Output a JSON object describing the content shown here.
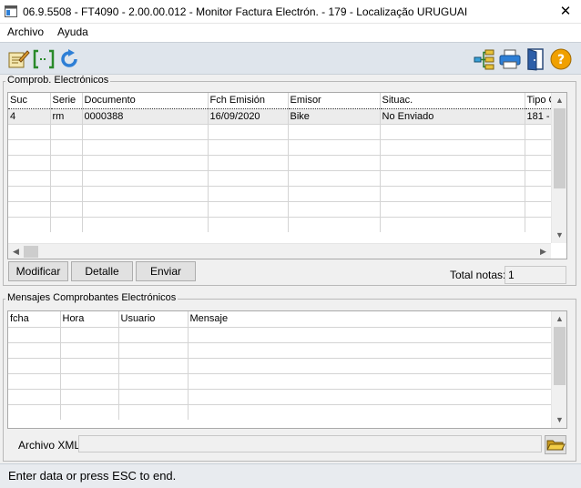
{
  "window": {
    "title": "06.9.5508 - FT4090 - 2.00.00.012 - Monitor Factura Electrón. - 179 - Localização URUGUAI",
    "close_glyph": "✕"
  },
  "menu": {
    "archivo": "Archivo",
    "ayuda": "Ayuda"
  },
  "toolbar": {
    "left_icons": [
      "document-edit-icon",
      "bracket-select-icon",
      "refresh-icon"
    ],
    "right_icons": [
      "tree-icon",
      "printer-icon",
      "exit-door-icon",
      "help-icon"
    ]
  },
  "comprobantes": {
    "group_label": "Comprob. Electrónicos",
    "columns": [
      "Suc",
      "Serie",
      "Documento",
      "Fch Emisión",
      "Emisor",
      "Situac.",
      "Tipo C"
    ],
    "rows": [
      [
        "4",
        "rm",
        "0000388",
        "16/09/2020",
        "Bike",
        "No Enviado",
        "181 -"
      ]
    ],
    "buttons": {
      "modificar": "Modificar",
      "detalle": "Detalle",
      "enviar": "Enviar"
    },
    "total_label": "Total notas:",
    "total_value": "1"
  },
  "mensajes": {
    "group_label": "Mensajes Comprobantes Electrónicos",
    "columns": [
      "fcha",
      "Hora",
      "Usuario",
      "Mensaje"
    ],
    "archivo_label": "Archivo XML:",
    "archivo_value": ""
  },
  "status": {
    "text": "Enter data or press ESC to end."
  },
  "colors": {
    "toolbar_bg": "#dfe5ec",
    "window_bg": "#f0f0f0",
    "help_icon": "#f0a000",
    "refresh_icon": "#2e7fd6"
  }
}
